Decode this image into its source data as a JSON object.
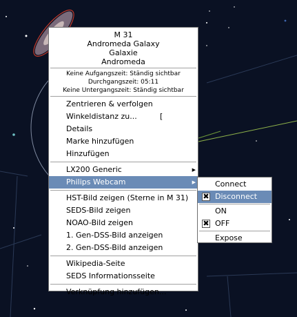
{
  "object_header": {
    "name": "M 31",
    "english": "Andromeda Galaxy",
    "german": "Galaxie",
    "constellation": "Andromeda",
    "rise": "Keine Aufgangszeit: Ständig sichtbar",
    "transit": "Durchgangszeit: 05:11",
    "set": "Keine Untergangszeit: Ständig sichtbar"
  },
  "menu": {
    "center_track": "Zentrieren & verfolgen",
    "angular_distance": "Winkeldistanz zu...",
    "angular_distance_mark": "[",
    "details": "Details",
    "add_marker": "Marke hinzufügen",
    "add": "Hinzufügen",
    "lx200": "LX200 Generic",
    "webcam": "Philips Webcam",
    "hst_image": "HST-Bild zeigen (Sterne in M 31)",
    "seds_image": "SEDS-Bild zeigen",
    "noao_image": "NOAO-Bild zeigen",
    "gen1_dss": "1. Gen-DSS-Bild anzeigen",
    "gen2_dss": "2. Gen-DSS-Bild anzeigen",
    "wikipedia": "Wikipedia-Seite",
    "seds_info": "SEDS Informationsseite",
    "add_link": "Verknüpfung hinzufügen...",
    "submenu_arrow": "▶"
  },
  "submenu": {
    "connect": "Connect",
    "disconnect": "Disconnect",
    "on": "ON",
    "off": "OFF",
    "expose": "Expose",
    "check_mark": "✖"
  },
  "colors": {
    "sky": "#0a1123",
    "highlight": "#6a8bb6",
    "galaxy_outline": "#c0392b",
    "ecliptic": "#8fb34a"
  }
}
